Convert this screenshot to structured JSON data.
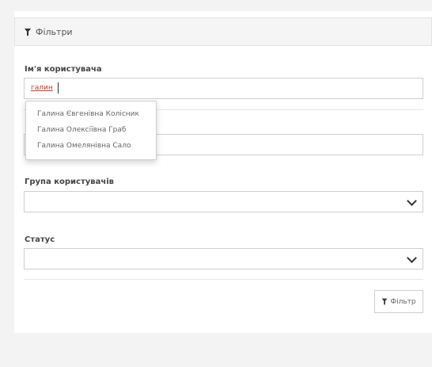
{
  "filters_panel": {
    "title": "Фільтри",
    "icon": "funnel-icon"
  },
  "fields": {
    "username": {
      "label": "Ім'я користувача",
      "value": "галин"
    },
    "user_group": {
      "label": "Група користувачів",
      "selected": ""
    },
    "status": {
      "label": "Статус",
      "selected": ""
    }
  },
  "autocomplete": {
    "items": [
      "Галина Євгенівна Колісник",
      "Галина Олексіївна Граб",
      "Галина Омелянівна Сало"
    ]
  },
  "actions": {
    "filter_button_label": "Фільтр"
  }
}
